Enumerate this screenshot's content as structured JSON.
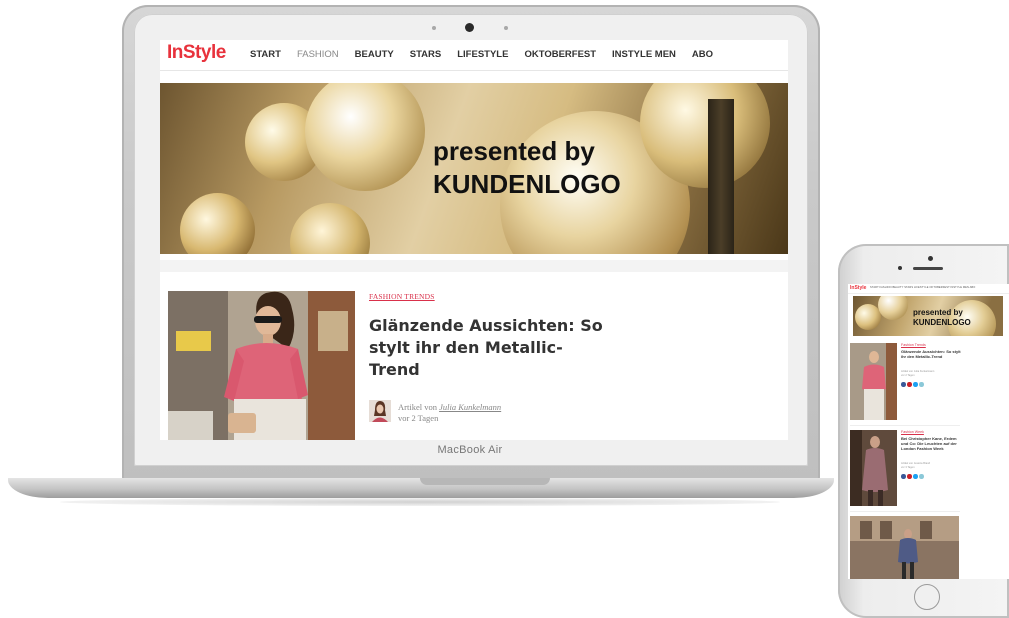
{
  "laptop": {
    "brand_label": "MacBook Air",
    "site": {
      "logo": "InStyle",
      "nav": {
        "items": [
          {
            "label": "START",
            "active": false
          },
          {
            "label": "FASHION",
            "active": true
          },
          {
            "label": "BEAUTY",
            "active": false
          },
          {
            "label": "STARS",
            "active": false
          },
          {
            "label": "LIFESTYLE",
            "active": false
          },
          {
            "label": "OKTOBERFEST",
            "active": false
          },
          {
            "label": "INSTYLE MEN",
            "active": false
          },
          {
            "label": "ABO",
            "active": false
          }
        ]
      },
      "hero": {
        "line1": "presented by",
        "line2": "KUNDENLOGO"
      },
      "article": {
        "category": "FASHION TRENDS",
        "headline": "Glänzende Aussichten: So stylt ihr den Metallic-Trend",
        "byline_prefix": "Artikel von",
        "author": "Julia Kunkelmann",
        "time": "vor 2 Tagen"
      }
    }
  },
  "phone": {
    "logo": "InStyle",
    "nav_line": "START   FASHION   BEAUTY   STARS   LIFESTYLE   OKTOBERFEST   INSTYLE MEN   ABO",
    "hero": {
      "line1": "presented by",
      "line2": "KUNDENLOGO"
    },
    "articles": [
      {
        "category": "Fashion Trends",
        "headline": "Glänzende Aussichten: So stylt ihr den Metallic-Trend",
        "byline": "Artikel von Julia Kunkelmann",
        "time": "vor 2 Tagen"
      },
      {
        "category": "Fashion Week",
        "headline": "Bei Christopher Kane, Erdem und Co: Die Leuchten auf der London Fashion Week",
        "byline": "Artikel von Jessica Brand",
        "time": "vor 3 Tagen"
      }
    ],
    "share_colors": [
      "#3b5998",
      "#cb2027",
      "#1da1f2",
      "#8bc8d8"
    ]
  },
  "colors": {
    "brand": "#e8323c",
    "category": "#d9304a"
  }
}
